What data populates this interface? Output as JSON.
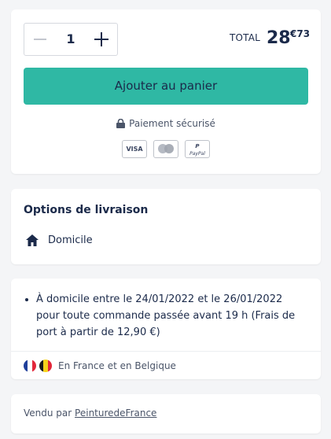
{
  "purchase": {
    "quantity": "1",
    "total_label": "TOTAL",
    "total_integer": "28",
    "total_decimal": "€73",
    "add_to_cart_label": "Ajouter au panier",
    "secure_payment_label": "Paiement sécurisé",
    "payment_methods": [
      {
        "name": "visa",
        "label": "VISA"
      },
      {
        "name": "mastercard",
        "label": ""
      },
      {
        "name": "paypal",
        "label": "PayPal"
      }
    ]
  },
  "delivery_options": {
    "title": "Options de livraison",
    "home_icon": "home-icon",
    "home_label": "Domicile"
  },
  "delivery_info": {
    "text": "À domicile entre le 24/01/2022 et le 26/01/2022 pour toute commande passée avant 19 h (Frais de port à partir de 12,90 €)",
    "regions_label": "En France et en Belgique",
    "flags": [
      "france-flag-icon",
      "belgium-flag-icon"
    ]
  },
  "vendor": {
    "prefix": "Vendu par",
    "name": "PeinturedeFrance"
  },
  "colors": {
    "accent": "#2fb8a4",
    "text_dark": "#1b2a4a",
    "background": "#f4f5f7"
  }
}
